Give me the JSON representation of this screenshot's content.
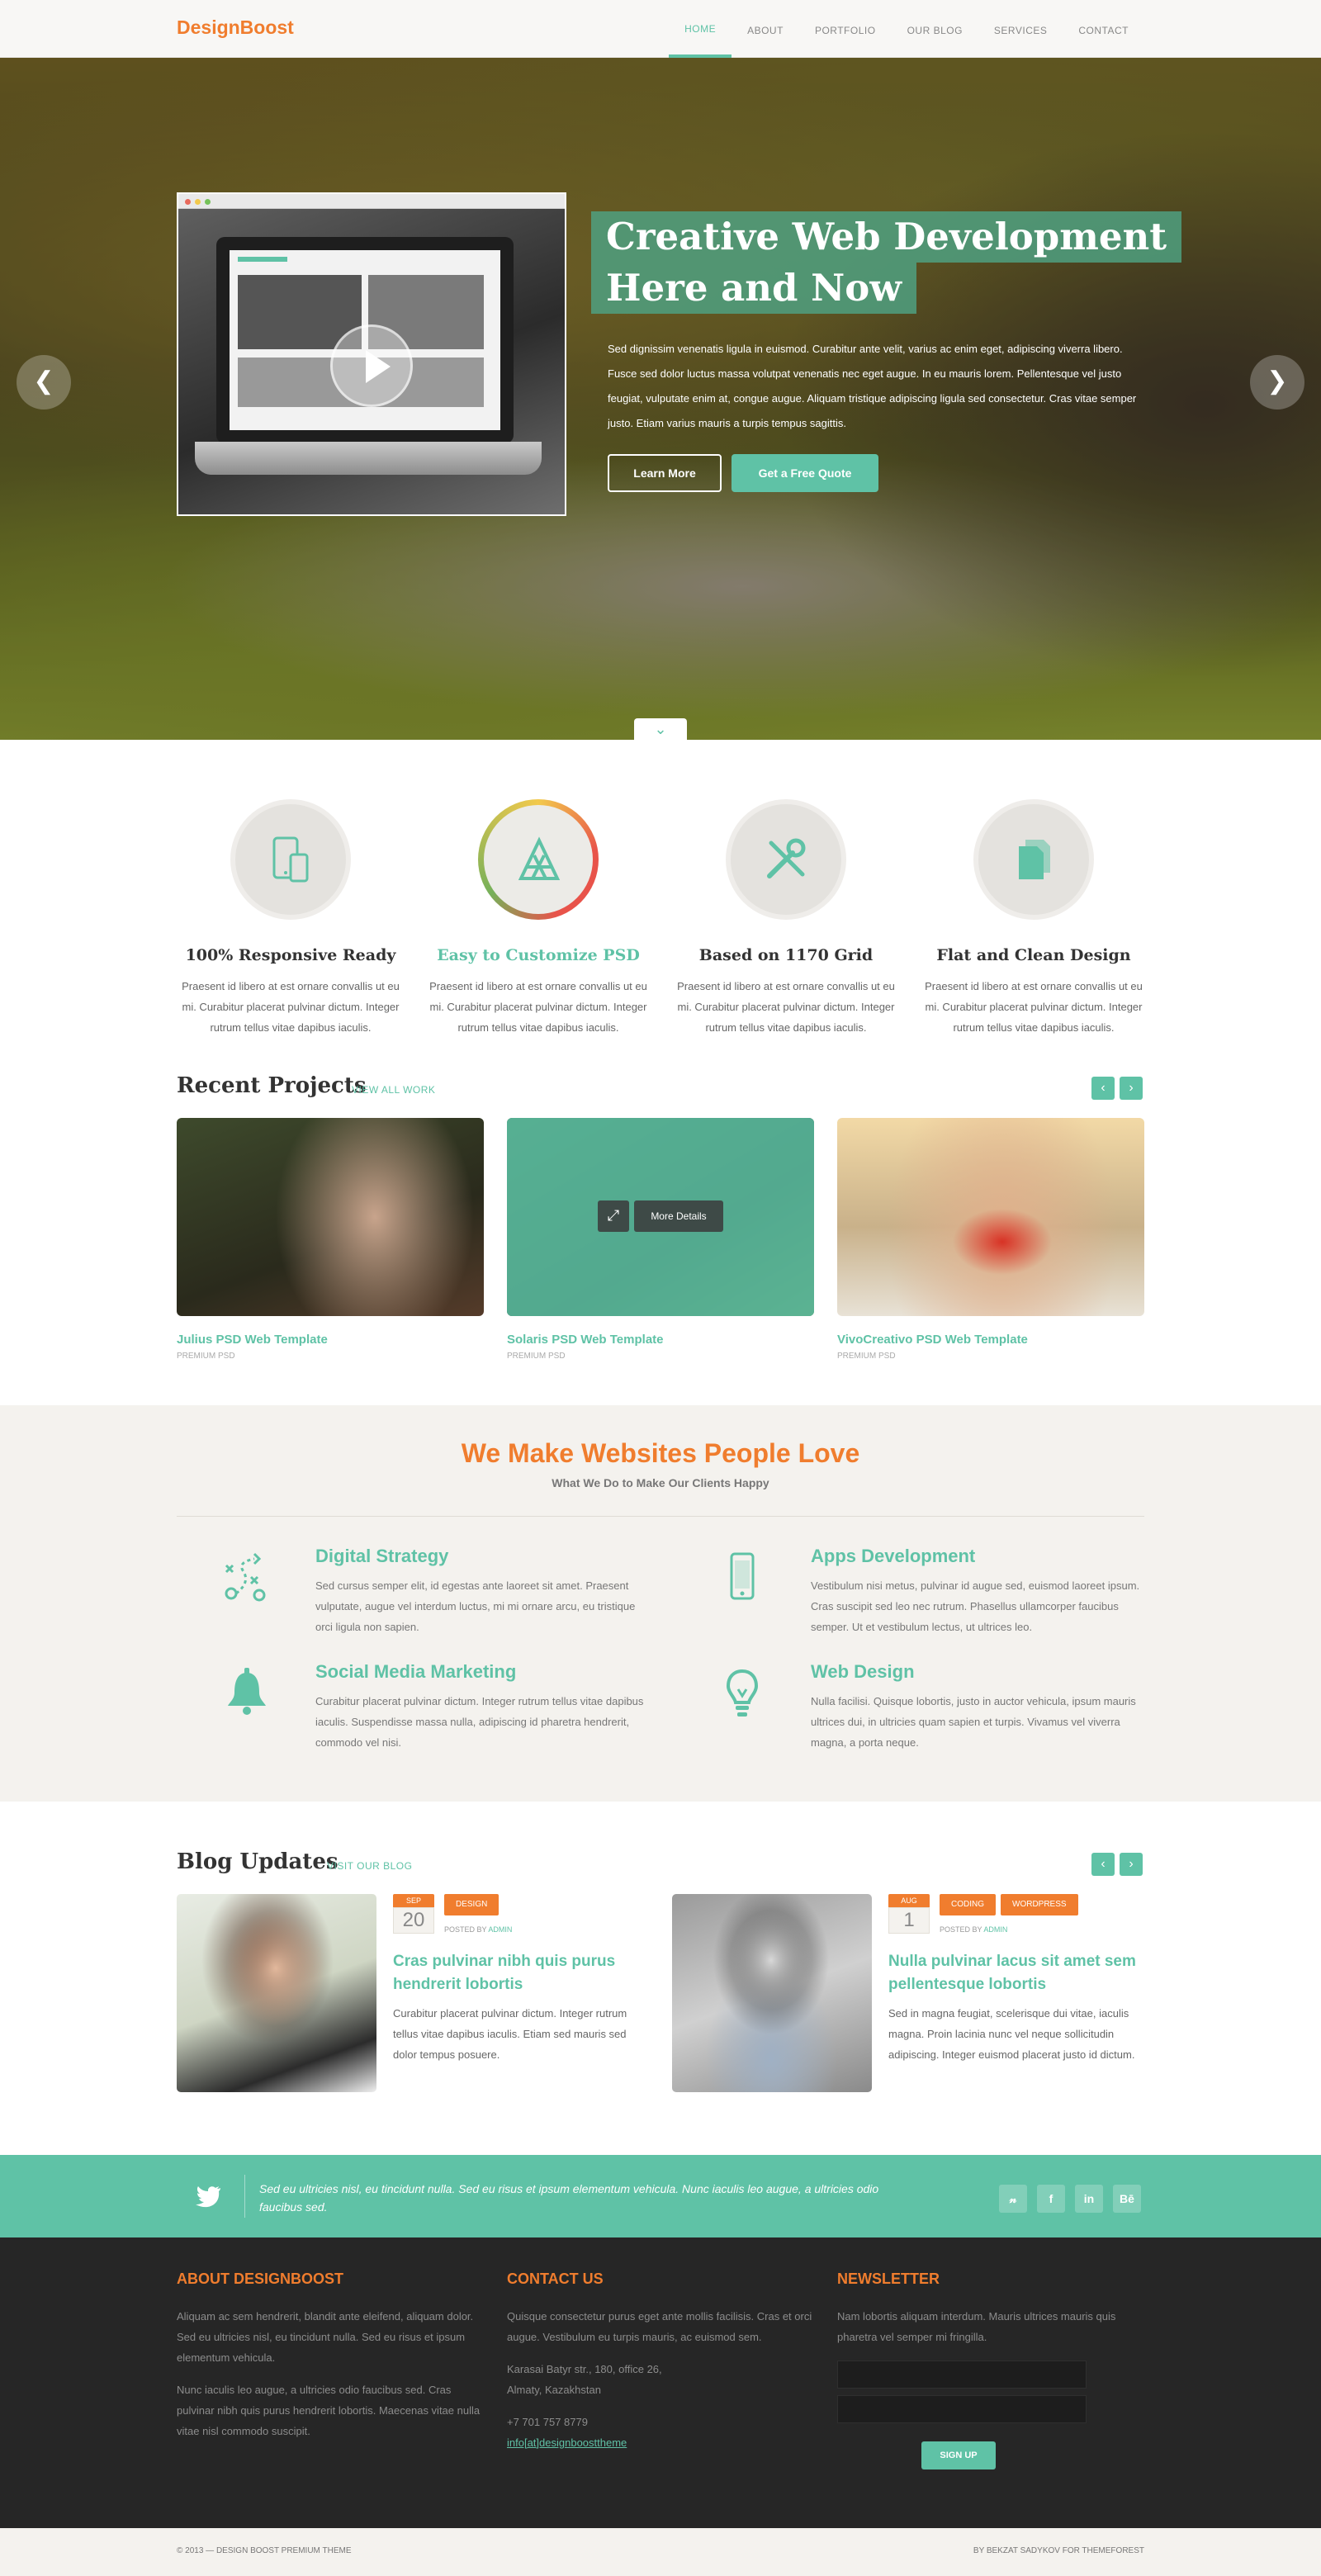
{
  "header": {
    "logo": "DesignBoost",
    "nav": [
      "HOME",
      "ABOUT",
      "PORTFOLIO",
      "OUR BLOG",
      "SERVICES",
      "CONTACT"
    ]
  },
  "hero": {
    "title_line1": "Creative Web Development",
    "title_line2": "Here and Now",
    "text": "Sed dignissim venenatis ligula in euismod. Curabitur ante velit, varius ac enim eget, adipiscing viverra libero. Fusce sed dolor luctus massa volutpat venenatis nec eget augue. In eu mauris lorem. Pellentesque vel justo feugiat, vulputate enim at, congue augue. Aliquam tristique adipiscing ligula sed consectetur. Cras vitae semper justo. Etiam varius mauris a turpis tempus sagittis.",
    "btn_learn": "Learn More",
    "btn_quote": "Get a Free Quote"
  },
  "features": [
    {
      "title": "100% Responsive Ready",
      "text": "Praesent id libero at est ornare convallis ut eu mi. Curabitur placerat pulvinar dictum. Integer rutrum tellus vitae dapibus iaculis.",
      "icon": "devices-icon"
    },
    {
      "title": "Easy to Customize PSD",
      "text": "Praesent id libero at est ornare convallis ut eu mi. Curabitur placerat pulvinar dictum. Integer rutrum tellus vitae dapibus iaculis.",
      "icon": "app-store-icon"
    },
    {
      "title": "Based on 1170 Grid",
      "text": "Praesent id libero at est ornare convallis ut eu mi. Curabitur placerat pulvinar dictum. Integer rutrum tellus vitae dapibus iaculis.",
      "icon": "tools-icon"
    },
    {
      "title": "Flat and Clean Design",
      "text": "Praesent id libero at est ornare convallis ut eu mi. Curabitur placerat pulvinar dictum. Integer rutrum tellus vitae dapibus iaculis.",
      "icon": "documents-icon"
    }
  ],
  "projects": {
    "title": "Recent Projects",
    "link": "VIEW ALL WORK",
    "more_details": "More Details",
    "items": [
      {
        "title": "Julius PSD Web Template",
        "sub": "PREMIUM PSD"
      },
      {
        "title": "Solaris PSD Web Template",
        "sub": "PREMIUM PSD"
      },
      {
        "title": "VivoCreativo PSD Web Template",
        "sub": "PREMIUM PSD"
      }
    ]
  },
  "services": {
    "title": "We Make Websites People Love",
    "subtitle": "What We Do to Make Our Clients Happy",
    "items": [
      {
        "title": "Digital Strategy",
        "text": "Sed cursus semper elit, id egestas ante laoreet sit amet. Praesent vulputate, augue vel interdum luctus, mi mi ornare arcu, eu tristique orci ligula non sapien."
      },
      {
        "title": "Apps Development",
        "text": "Vestibulum nisi metus, pulvinar id augue sed, euismod laoreet ipsum. Cras suscipit sed leo nec rutrum. Phasellus ullamcorper faucibus semper. Ut et vestibulum lectus, ut ultrices leo."
      },
      {
        "title": "Social Media Marketing",
        "text": "Curabitur placerat pulvinar dictum. Integer rutrum tellus vitae dapibus iaculis. Suspendisse massa nulla, adipiscing id pharetra hendrerit, commodo vel nisi."
      },
      {
        "title": "Web Design",
        "text": "Nulla facilisi. Quisque lobortis, justo in auctor vehicula, ipsum mauris ultrices dui, in ultricies quam sapien et turpis. Vivamus vel viverra magna, a porta neque."
      }
    ]
  },
  "blog": {
    "title": "Blog Updates",
    "link": "VISIT OUR BLOG",
    "posted_by": "POSTED BY",
    "author": "ADMIN",
    "posts": [
      {
        "month": "SEP",
        "day": "20",
        "tags": [
          "DESIGN"
        ],
        "title": "Cras pulvinar nibh quis purus hendrerit lobortis",
        "text": "Curabitur placerat pulvinar dictum. Integer rutrum tellus vitae dapibus iaculis. Etiam sed mauris sed dolor tempus posuere."
      },
      {
        "month": "AUG",
        "day": "1",
        "tags": [
          "CODING",
          "WORDPRESS"
        ],
        "title": "Nulla pulvinar lacus sit amet sem pellentesque lobortis",
        "text": "Sed in magna feugiat, scelerisque dui vitae, iaculis magna. Proin lacinia nunc vel neque sollicitudin adipiscing. Integer euismod placerat justo id dictum."
      }
    ]
  },
  "tweet": {
    "text": "Sed eu ultricies nisl, eu tincidunt nulla. Sed eu risus et ipsum elementum vehicula. Nunc iaculis leo augue, a ultricies odio faucibus sed.",
    "social": [
      "twitter-icon",
      "facebook-icon",
      "linkedin-icon",
      "behance-icon"
    ]
  },
  "footer": {
    "about_title": "ABOUT DESIGNBOOST",
    "about_p1": "Aliquam ac sem hendrerit, blandit ante eleifend, aliquam dolor. Sed eu ultricies nisl, eu tincidunt nulla. Sed eu risus et ipsum elementum vehicula.",
    "about_p2": "Nunc iaculis leo augue, a ultricies odio faucibus sed. Cras pulvinar nibh quis purus hendrerit lobortis. Maecenas vitae nulla vitae nisl commodo suscipit.",
    "contact_title": "CONTACT US",
    "contact_text": "Quisque consectetur purus eget ante mollis facilisis. Cras et orci augue. Vestibulum eu turpis mauris, ac euismod sem.",
    "address1": "Karasai Batyr str., 180, office 26,",
    "address2": "Almaty, Kazakhstan",
    "phone": "+7 701 757 8779",
    "email": "info[at]designboosttheme",
    "newsletter_title": "NEWSLETTER",
    "newsletter_text": "Nam lobortis aliquam interdum. Mauris ultrices mauris quis pharetra vel semper mi fringilla.",
    "signup": "SIGN UP",
    "copyright": "© 2013 — DESIGN BOOST PREMIUM THEME",
    "credit": "BY BEKZAT SADYKOV FOR THEMEFOREST"
  },
  "colors": {
    "accent": "#5fc2a6",
    "brand": "#f07d2e",
    "footer_bg": "#262626"
  }
}
